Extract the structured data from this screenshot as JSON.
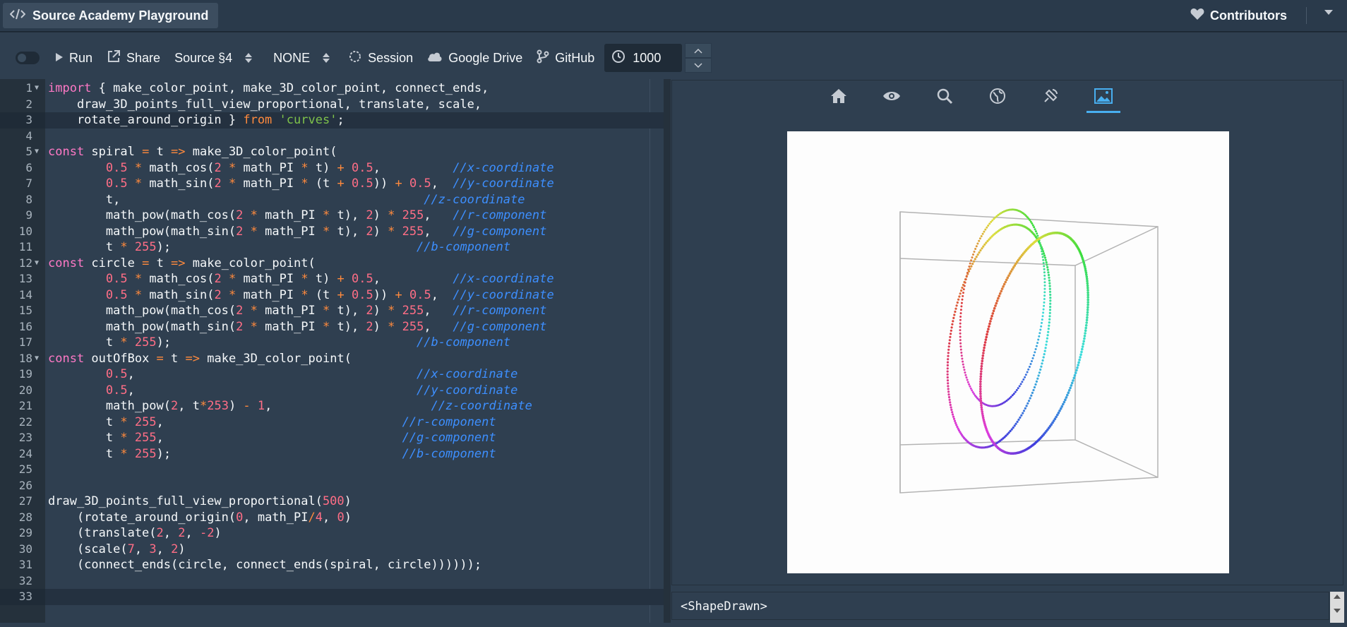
{
  "header": {
    "title": "Source Academy Playground",
    "contributors_label": "Contributors"
  },
  "toolbar": {
    "run_label": "Run",
    "share_label": "Share",
    "language_label": "Source §4",
    "variant_label": "NONE",
    "session_label": "Session",
    "drive_label": "Google Drive",
    "github_label": "GitHub",
    "timeout_value": "1000"
  },
  "editor": {
    "lines": [
      {
        "n": "1",
        "fold": true
      },
      {
        "n": "2"
      },
      {
        "n": "3"
      },
      {
        "n": "4"
      },
      {
        "n": "5",
        "fold": true
      },
      {
        "n": "6"
      },
      {
        "n": "7"
      },
      {
        "n": "8"
      },
      {
        "n": "9"
      },
      {
        "n": "10"
      },
      {
        "n": "11"
      },
      {
        "n": "12",
        "fold": true
      },
      {
        "n": "13"
      },
      {
        "n": "14"
      },
      {
        "n": "15"
      },
      {
        "n": "16"
      },
      {
        "n": "17"
      },
      {
        "n": "18",
        "fold": true
      },
      {
        "n": "19"
      },
      {
        "n": "20"
      },
      {
        "n": "21"
      },
      {
        "n": "22"
      },
      {
        "n": "23"
      },
      {
        "n": "24"
      },
      {
        "n": "25"
      },
      {
        "n": "26"
      },
      {
        "n": "27"
      },
      {
        "n": "28"
      },
      {
        "n": "29"
      },
      {
        "n": "30"
      },
      {
        "n": "31"
      },
      {
        "n": "32"
      },
      {
        "n": "33"
      }
    ],
    "code": [
      [
        [
          "k",
          "import"
        ],
        [
          "t",
          " { make_color_point, make_3D_color_point, connect_ends,"
        ]
      ],
      [
        [
          "t",
          "    draw_3D_points_full_view_proportional, translate, scale,"
        ]
      ],
      [
        [
          "t",
          "    rotate_around_origin } "
        ],
        [
          "o",
          "from"
        ],
        [
          "t",
          " "
        ],
        [
          "s",
          "'curves'"
        ],
        [
          "t",
          ";"
        ]
      ],
      [],
      [
        [
          "k",
          "const"
        ],
        [
          "t",
          " spiral "
        ],
        [
          "o",
          "="
        ],
        [
          "t",
          " t "
        ],
        [
          "o",
          "=>"
        ],
        [
          "t",
          " make_3D_color_point("
        ]
      ],
      [
        [
          "t",
          "        "
        ],
        [
          "n",
          "0.5"
        ],
        [
          "t",
          " "
        ],
        [
          "o",
          "*"
        ],
        [
          "t",
          " math_cos("
        ],
        [
          "n",
          "2"
        ],
        [
          "t",
          " "
        ],
        [
          "o",
          "*"
        ],
        [
          "t",
          " math_PI "
        ],
        [
          "o",
          "*"
        ],
        [
          "t",
          " t) "
        ],
        [
          "o",
          "+"
        ],
        [
          "t",
          " "
        ],
        [
          "n",
          "0.5"
        ],
        [
          "t",
          ",          "
        ],
        [
          "c",
          "//x-coordinate"
        ]
      ],
      [
        [
          "t",
          "        "
        ],
        [
          "n",
          "0.5"
        ],
        [
          "t",
          " "
        ],
        [
          "o",
          "*"
        ],
        [
          "t",
          " math_sin("
        ],
        [
          "n",
          "2"
        ],
        [
          "t",
          " "
        ],
        [
          "o",
          "*"
        ],
        [
          "t",
          " math_PI "
        ],
        [
          "o",
          "*"
        ],
        [
          "t",
          " (t "
        ],
        [
          "o",
          "+"
        ],
        [
          "t",
          " "
        ],
        [
          "n",
          "0.5"
        ],
        [
          "t",
          ")) "
        ],
        [
          "o",
          "+"
        ],
        [
          "t",
          " "
        ],
        [
          "n",
          "0.5"
        ],
        [
          "t",
          ",  "
        ],
        [
          "c",
          "//y-coordinate"
        ]
      ],
      [
        [
          "t",
          "        t,                                          "
        ],
        [
          "c",
          "//z-coordinate"
        ]
      ],
      [
        [
          "t",
          "        math_pow(math_cos("
        ],
        [
          "n",
          "2"
        ],
        [
          "t",
          " "
        ],
        [
          "o",
          "*"
        ],
        [
          "t",
          " math_PI "
        ],
        [
          "o",
          "*"
        ],
        [
          "t",
          " t), "
        ],
        [
          "n",
          "2"
        ],
        [
          "t",
          ") "
        ],
        [
          "o",
          "*"
        ],
        [
          "t",
          " "
        ],
        [
          "n",
          "255"
        ],
        [
          "t",
          ",   "
        ],
        [
          "c",
          "//r-component"
        ]
      ],
      [
        [
          "t",
          "        math_pow(math_sin("
        ],
        [
          "n",
          "2"
        ],
        [
          "t",
          " "
        ],
        [
          "o",
          "*"
        ],
        [
          "t",
          " math_PI "
        ],
        [
          "o",
          "*"
        ],
        [
          "t",
          " t), "
        ],
        [
          "n",
          "2"
        ],
        [
          "t",
          ") "
        ],
        [
          "o",
          "*"
        ],
        [
          "t",
          " "
        ],
        [
          "n",
          "255"
        ],
        [
          "t",
          ",   "
        ],
        [
          "c",
          "//g-component"
        ]
      ],
      [
        [
          "t",
          "        t "
        ],
        [
          "o",
          "*"
        ],
        [
          "t",
          " "
        ],
        [
          "n",
          "255"
        ],
        [
          "t",
          ");                                  "
        ],
        [
          "c",
          "//b-component"
        ]
      ],
      [
        [
          "k",
          "const"
        ],
        [
          "t",
          " circle "
        ],
        [
          "o",
          "="
        ],
        [
          "t",
          " t "
        ],
        [
          "o",
          "=>"
        ],
        [
          "t",
          " make_color_point("
        ]
      ],
      [
        [
          "t",
          "        "
        ],
        [
          "n",
          "0.5"
        ],
        [
          "t",
          " "
        ],
        [
          "o",
          "*"
        ],
        [
          "t",
          " math_cos("
        ],
        [
          "n",
          "2"
        ],
        [
          "t",
          " "
        ],
        [
          "o",
          "*"
        ],
        [
          "t",
          " math_PI "
        ],
        [
          "o",
          "*"
        ],
        [
          "t",
          " t) "
        ],
        [
          "o",
          "+"
        ],
        [
          "t",
          " "
        ],
        [
          "n",
          "0.5"
        ],
        [
          "t",
          ",          "
        ],
        [
          "c",
          "//x-coordinate"
        ]
      ],
      [
        [
          "t",
          "        "
        ],
        [
          "n",
          "0.5"
        ],
        [
          "t",
          " "
        ],
        [
          "o",
          "*"
        ],
        [
          "t",
          " math_sin("
        ],
        [
          "n",
          "2"
        ],
        [
          "t",
          " "
        ],
        [
          "o",
          "*"
        ],
        [
          "t",
          " math_PI "
        ],
        [
          "o",
          "*"
        ],
        [
          "t",
          " (t "
        ],
        [
          "o",
          "+"
        ],
        [
          "t",
          " "
        ],
        [
          "n",
          "0.5"
        ],
        [
          "t",
          ")) "
        ],
        [
          "o",
          "+"
        ],
        [
          "t",
          " "
        ],
        [
          "n",
          "0.5"
        ],
        [
          "t",
          ",  "
        ],
        [
          "c",
          "//y-coordinate"
        ]
      ],
      [
        [
          "t",
          "        math_pow(math_cos("
        ],
        [
          "n",
          "2"
        ],
        [
          "t",
          " "
        ],
        [
          "o",
          "*"
        ],
        [
          "t",
          " math_PI "
        ],
        [
          "o",
          "*"
        ],
        [
          "t",
          " t), "
        ],
        [
          "n",
          "2"
        ],
        [
          "t",
          ") "
        ],
        [
          "o",
          "*"
        ],
        [
          "t",
          " "
        ],
        [
          "n",
          "255"
        ],
        [
          "t",
          ",   "
        ],
        [
          "c",
          "//r-component"
        ]
      ],
      [
        [
          "t",
          "        math_pow(math_sin("
        ],
        [
          "n",
          "2"
        ],
        [
          "t",
          " "
        ],
        [
          "o",
          "*"
        ],
        [
          "t",
          " math_PI "
        ],
        [
          "o",
          "*"
        ],
        [
          "t",
          " t), "
        ],
        [
          "n",
          "2"
        ],
        [
          "t",
          ") "
        ],
        [
          "o",
          "*"
        ],
        [
          "t",
          " "
        ],
        [
          "n",
          "255"
        ],
        [
          "t",
          ",   "
        ],
        [
          "c",
          "//g-component"
        ]
      ],
      [
        [
          "t",
          "        t "
        ],
        [
          "o",
          "*"
        ],
        [
          "t",
          " "
        ],
        [
          "n",
          "255"
        ],
        [
          "t",
          ");                                  "
        ],
        [
          "c",
          "//b-component"
        ]
      ],
      [
        [
          "k",
          "const"
        ],
        [
          "t",
          " outOfBox "
        ],
        [
          "o",
          "="
        ],
        [
          "t",
          " t "
        ],
        [
          "o",
          "=>"
        ],
        [
          "t",
          " make_3D_color_point("
        ]
      ],
      [
        [
          "t",
          "        "
        ],
        [
          "n",
          "0.5"
        ],
        [
          "t",
          ",                                       "
        ],
        [
          "c",
          "//x-coordinate"
        ]
      ],
      [
        [
          "t",
          "        "
        ],
        [
          "n",
          "0.5"
        ],
        [
          "t",
          ",                                       "
        ],
        [
          "c",
          "//y-coordinate"
        ]
      ],
      [
        [
          "t",
          "        math_pow("
        ],
        [
          "n",
          "2"
        ],
        [
          "t",
          ", t"
        ],
        [
          "o",
          "*"
        ],
        [
          "n",
          "253"
        ],
        [
          "t",
          ") "
        ],
        [
          "o",
          "-"
        ],
        [
          "t",
          " "
        ],
        [
          "n",
          "1"
        ],
        [
          "t",
          ",                      "
        ],
        [
          "c",
          "//z-coordinate"
        ]
      ],
      [
        [
          "t",
          "        t "
        ],
        [
          "o",
          "*"
        ],
        [
          "t",
          " "
        ],
        [
          "n",
          "255"
        ],
        [
          "t",
          ",                                 "
        ],
        [
          "c",
          "//r-component"
        ]
      ],
      [
        [
          "t",
          "        t "
        ],
        [
          "o",
          "*"
        ],
        [
          "t",
          " "
        ],
        [
          "n",
          "255"
        ],
        [
          "t",
          ",                                 "
        ],
        [
          "c",
          "//g-component"
        ]
      ],
      [
        [
          "t",
          "        t "
        ],
        [
          "o",
          "*"
        ],
        [
          "t",
          " "
        ],
        [
          "n",
          "255"
        ],
        [
          "t",
          ");                                "
        ],
        [
          "c",
          "//b-component"
        ]
      ],
      [],
      [],
      [
        [
          "t",
          "draw_3D_points_full_view_proportional("
        ],
        [
          "n",
          "500"
        ],
        [
          "t",
          ")"
        ]
      ],
      [
        [
          "t",
          "    (rotate_around_origin("
        ],
        [
          "n",
          "0"
        ],
        [
          "t",
          ", math_PI"
        ],
        [
          "o",
          "/"
        ],
        [
          "n",
          "4"
        ],
        [
          "t",
          ", "
        ],
        [
          "n",
          "0"
        ],
        [
          "t",
          ")"
        ]
      ],
      [
        [
          "t",
          "    (translate("
        ],
        [
          "n",
          "2"
        ],
        [
          "t",
          ", "
        ],
        [
          "n",
          "2"
        ],
        [
          "t",
          ", "
        ],
        [
          "n",
          "-2"
        ],
        [
          "t",
          ")"
        ]
      ],
      [
        [
          "t",
          "    (scale("
        ],
        [
          "n",
          "7"
        ],
        [
          "t",
          ", "
        ],
        [
          "n",
          "3"
        ],
        [
          "t",
          ", "
        ],
        [
          "n",
          "2"
        ],
        [
          "t",
          ")"
        ]
      ],
      [
        [
          "t",
          "    (connect_ends(circle, connect_ends(spiral, circle))))));"
        ]
      ],
      [],
      []
    ],
    "active_lines": [
      "3",
      "33"
    ]
  },
  "viewer": {
    "tabs": [
      "home-icon",
      "eye-icon",
      "search-icon",
      "globe-icon",
      "satellite-icon",
      "image-icon"
    ],
    "active_tab": "image-icon"
  },
  "console": {
    "output": "<ShapeDrawn>"
  },
  "colors": {
    "accent": "#48aff0",
    "keyword": "#ff79c6",
    "string": "#7ec24a",
    "number": "#ff6e86",
    "operator": "#ff8a3d",
    "comment": "#3d8fff"
  }
}
